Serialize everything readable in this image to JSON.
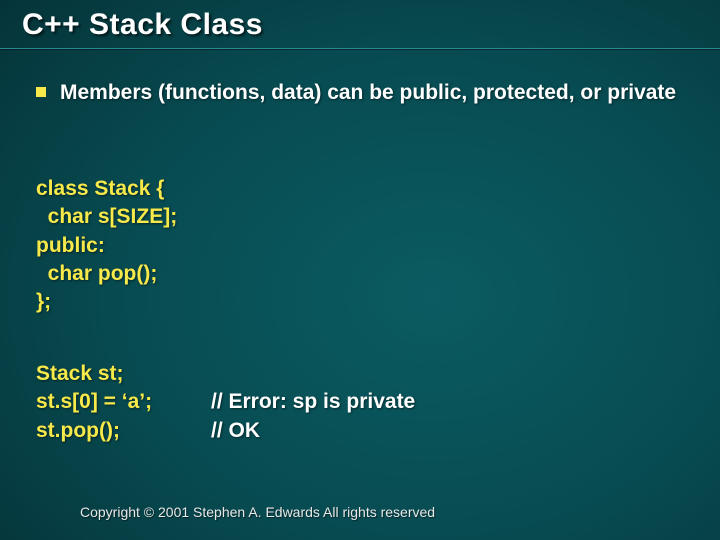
{
  "title": "C++ Stack Class",
  "bullet": "Members (functions, data) can be public, protected, or private",
  "code1": {
    "l1": "class Stack {",
    "l2": "  char s[SIZE];",
    "l3": "public:",
    "l4": "  char pop();",
    "l5": "};"
  },
  "code2": {
    "r1_left": "Stack st;",
    "r2_left": "st.s[0] = ‘a’;",
    "r2_right": "// Error: sp is private",
    "r3_left": "st.pop();",
    "r3_right": "// OK"
  },
  "footer": "Copyright © 2001 Stephen A. Edwards  All rights reserved"
}
